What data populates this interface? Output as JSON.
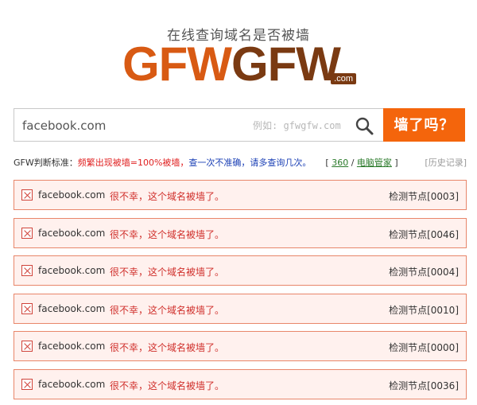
{
  "header": {
    "tagline": "在线查询域名是否被墙",
    "logo_part1": "GFW",
    "logo_part2": "GFW",
    "logo_domain": ".com"
  },
  "search": {
    "value": "facebook.com",
    "hint": "例如: gfwgfw.com",
    "button_label": "墙了吗？"
  },
  "criteria": {
    "label": "GFW判断标准：",
    "rule_red": "频繁出现被墙=100%被墙，",
    "rule_blue": "查一次不准确，请多查询几次。",
    "bracket_open": "[ ",
    "link_360": "360",
    "separator": " / ",
    "link_pc": "电脑管家",
    "bracket_close": " ]",
    "history": "[历史记录]"
  },
  "results": [
    {
      "domain": "facebook.com",
      "status": "很不幸，这个域名被墙了。",
      "node": "检测节点[0003]"
    },
    {
      "domain": "facebook.com",
      "status": "很不幸，这个域名被墙了。",
      "node": "检测节点[0046]"
    },
    {
      "domain": "facebook.com",
      "status": "很不幸，这个域名被墙了。",
      "node": "检测节点[0004]"
    },
    {
      "domain": "facebook.com",
      "status": "很不幸，这个域名被墙了。",
      "node": "检测节点[0010]"
    },
    {
      "domain": "facebook.com",
      "status": "很不幸，这个域名被墙了。",
      "node": "检测节点[0000]"
    },
    {
      "domain": "facebook.com",
      "status": "很不幸，这个域名被墙了。",
      "node": "检测节点[0036]"
    }
  ],
  "colors": {
    "accent": "#f4650c",
    "logo_orange": "#d85a13",
    "logo_brown": "#7a3a12",
    "blocked_bg": "#fff1ee",
    "blocked_border": "#e8866a",
    "blocked_text": "#d0312d"
  },
  "icons": {
    "search": "search-icon",
    "blocked": "blocked-x-icon"
  }
}
